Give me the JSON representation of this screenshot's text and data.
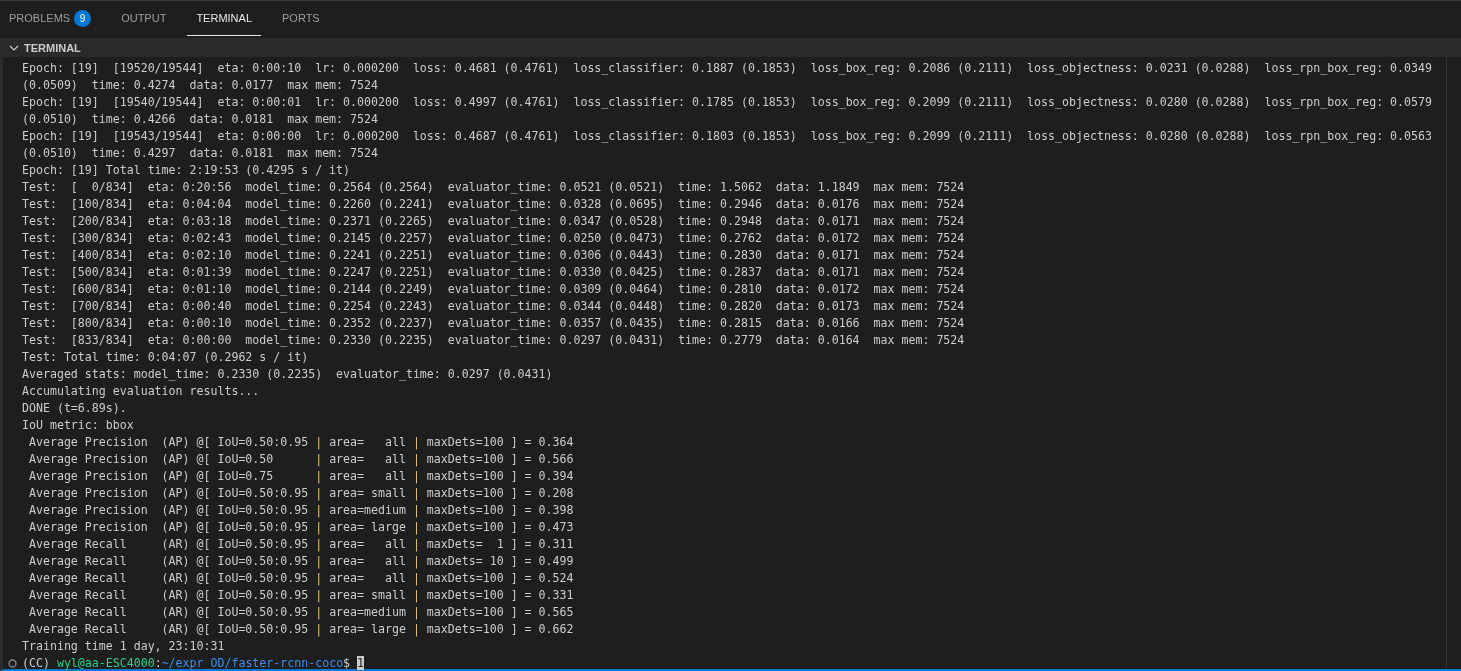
{
  "tabs": [
    {
      "label": "PROBLEMS",
      "badge": "9",
      "selected": false
    },
    {
      "label": "OUTPUT",
      "selected": false
    },
    {
      "label": "TERMINAL",
      "selected": true
    },
    {
      "label": "PORTS",
      "selected": false
    }
  ],
  "section": {
    "title": "TERMINAL",
    "expanded": true
  },
  "terminal": {
    "lines": [
      "Epoch: [19]  [19520/19544]  eta: 0:00:10  lr: 0.000200  loss: 0.4681 (0.4761)  loss_classifier: 0.1887 (0.1853)  loss_box_reg: 0.2086 (0.2111)  loss_objectness: 0.0231 (0.0288)  loss_rpn_box_reg: 0.0349",
      "(0.0509)  time: 0.4274  data: 0.0177  max mem: 7524",
      "Epoch: [19]  [19540/19544]  eta: 0:00:01  lr: 0.000200  loss: 0.4997 (0.4761)  loss_classifier: 0.1785 (0.1853)  loss_box_reg: 0.2099 (0.2111)  loss_objectness: 0.0280 (0.0288)  loss_rpn_box_reg: 0.0579",
      "(0.0510)  time: 0.4266  data: 0.0181  max mem: 7524",
      "Epoch: [19]  [19543/19544]  eta: 0:00:00  lr: 0.000200  loss: 0.4687 (0.4761)  loss_classifier: 0.1803 (0.1853)  loss_box_reg: 0.2099 (0.2111)  loss_objectness: 0.0280 (0.0288)  loss_rpn_box_reg: 0.0563",
      "(0.0510)  time: 0.4297  data: 0.0181  max mem: 7524",
      "Epoch: [19] Total time: 2:19:53 (0.4295 s / it)",
      "Test:  [  0/834]  eta: 0:20:56  model_time: 0.2564 (0.2564)  evaluator_time: 0.0521 (0.0521)  time: 1.5062  data: 1.1849  max mem: 7524",
      "Test:  [100/834]  eta: 0:04:04  model_time: 0.2260 (0.2241)  evaluator_time: 0.0328 (0.0695)  time: 0.2946  data: 0.0176  max mem: 7524",
      "Test:  [200/834]  eta: 0:03:18  model_time: 0.2371 (0.2265)  evaluator_time: 0.0347 (0.0528)  time: 0.2948  data: 0.0171  max mem: 7524",
      "Test:  [300/834]  eta: 0:02:43  model_time: 0.2145 (0.2257)  evaluator_time: 0.0250 (0.0473)  time: 0.2762  data: 0.0172  max mem: 7524",
      "Test:  [400/834]  eta: 0:02:10  model_time: 0.2241 (0.2251)  evaluator_time: 0.0306 (0.0443)  time: 0.2830  data: 0.0171  max mem: 7524",
      "Test:  [500/834]  eta: 0:01:39  model_time: 0.2247 (0.2251)  evaluator_time: 0.0330 (0.0425)  time: 0.2837  data: 0.0171  max mem: 7524",
      "Test:  [600/834]  eta: 0:01:10  model_time: 0.2144 (0.2249)  evaluator_time: 0.0309 (0.0464)  time: 0.2810  data: 0.0172  max mem: 7524",
      "Test:  [700/834]  eta: 0:00:40  model_time: 0.2254 (0.2243)  evaluator_time: 0.0344 (0.0448)  time: 0.2820  data: 0.0173  max mem: 7524",
      "Test:  [800/834]  eta: 0:00:10  model_time: 0.2352 (0.2237)  evaluator_time: 0.0357 (0.0435)  time: 0.2815  data: 0.0166  max mem: 7524",
      "Test:  [833/834]  eta: 0:00:00  model_time: 0.2330 (0.2235)  evaluator_time: 0.0297 (0.0431)  time: 0.2779  data: 0.0164  max mem: 7524",
      "Test: Total time: 0:04:07 (0.2962 s / it)",
      "Averaged stats: model_time: 0.2330 (0.2235)  evaluator_time: 0.0297 (0.0431)",
      "Accumulating evaluation results...",
      "DONE (t=6.89s).",
      "IoU metric: bbox",
      " Average Precision  (AP) @[ IoU=0.50:0.95 | area=   all | maxDets=100 ] = 0.364",
      " Average Precision  (AP) @[ IoU=0.50      | area=   all | maxDets=100 ] = 0.566",
      " Average Precision  (AP) @[ IoU=0.75      | area=   all | maxDets=100 ] = 0.394",
      " Average Precision  (AP) @[ IoU=0.50:0.95 | area= small | maxDets=100 ] = 0.208",
      " Average Precision  (AP) @[ IoU=0.50:0.95 | area=medium | maxDets=100 ] = 0.398",
      " Average Precision  (AP) @[ IoU=0.50:0.95 | area= large | maxDets=100 ] = 0.473",
      " Average Recall     (AR) @[ IoU=0.50:0.95 | area=   all | maxDets=  1 ] = 0.311",
      " Average Recall     (AR) @[ IoU=0.50:0.95 | area=   all | maxDets= 10 ] = 0.499",
      " Average Recall     (AR) @[ IoU=0.50:0.95 | area=   all | maxDets=100 ] = 0.524",
      " Average Recall     (AR) @[ IoU=0.50:0.95 | area= small | maxDets=100 ] = 0.331",
      " Average Recall     (AR) @[ IoU=0.50:0.95 | area=medium | maxDets=100 ] = 0.565",
      " Average Recall     (AR) @[ IoU=0.50:0.95 | area= large | maxDets=100 ] = 0.662",
      "Training time 1 day, 23:10:31"
    ],
    "prompt": {
      "env": "(CC)",
      "user_host": "wyl@aa-ESC4000",
      "separator": ":",
      "path": "~/expr_OD/faster-rcnn-coco",
      "symbol": "$",
      "input": "1"
    }
  }
}
